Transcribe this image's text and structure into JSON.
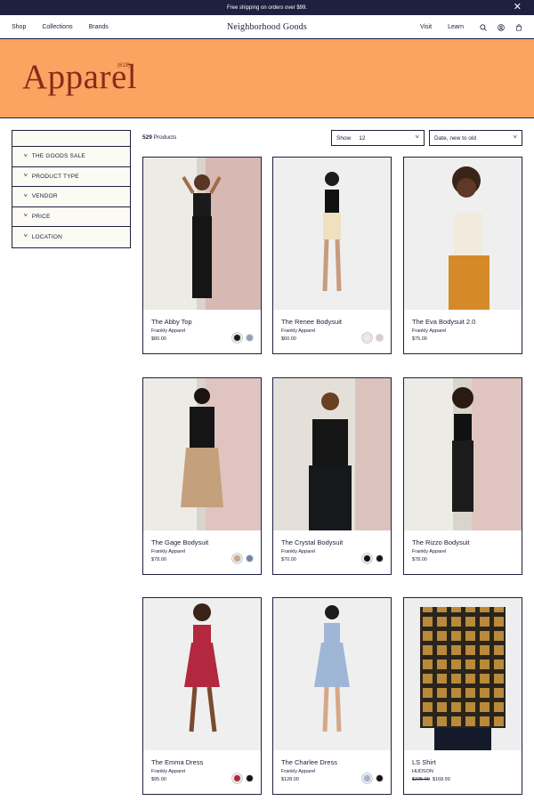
{
  "announcement": {
    "text": "Free shipping on orders over $99."
  },
  "header": {
    "nav_left": [
      "Shop",
      "Collections",
      "Brands"
    ],
    "logo": "Neighborhood Goods",
    "nav_right": [
      "Visit",
      "Learn"
    ],
    "icons": [
      "search-icon",
      "account-icon",
      "cart-icon"
    ]
  },
  "hero": {
    "title": "Apparel",
    "count": "(619)"
  },
  "sidebar": {
    "filters": [
      "THE GOODS SALE",
      "PRODUCT TYPE",
      "VENDOR",
      "PRICE",
      "LOCATION"
    ]
  },
  "toolbar": {
    "product_count": "529",
    "product_label": "Products",
    "show_label": "Show",
    "show_value": "12",
    "sort_value": "Date, new to old"
  },
  "products": [
    {
      "name": "The Abby Top",
      "vendor": "Frankly Apparel",
      "price": "$80.00",
      "swatches": [
        "#1c1c1c",
        "#8fa2b8"
      ]
    },
    {
      "name": "The Renee Bodysuit",
      "vendor": "Frankly Apparel",
      "price": "$60.00",
      "swatches": [
        "#efece4",
        "#d9c9d0"
      ]
    },
    {
      "name": "The Eva Bodysuit 2.0",
      "vendor": "Frankly Apparel",
      "price": "$75.00",
      "swatches": []
    },
    {
      "name": "The Gage Bodysuit",
      "vendor": "Frankly Apparel",
      "price": "$78.00",
      "swatches": [
        "#c9a98c",
        "#6f86a6"
      ]
    },
    {
      "name": "The Crystal Bodysuit",
      "vendor": "Frankly Apparel",
      "price": "$70.00",
      "swatches": [
        "#151515",
        "#151515"
      ]
    },
    {
      "name": "The Rizzo Bodysuit",
      "vendor": "Frankly Apparel",
      "price": "$78.00",
      "swatches": []
    },
    {
      "name": "The Emma Dress",
      "vendor": "Frankly Apparel",
      "price": "$95.00",
      "swatches": [
        "#b3283f",
        "#151515"
      ]
    },
    {
      "name": "The Charlee Dress",
      "vendor": "Frankly Apparel",
      "price": "$128.00",
      "swatches": [
        "#9fb6d6",
        "#151515"
      ]
    },
    {
      "name": "LS Shirt",
      "vendor": "HUDSON",
      "price_original": "$225.00",
      "price": "$168.99",
      "swatches": []
    }
  ],
  "colors": {
    "navy": "#1f2040",
    "hero_orange": "#fba462",
    "hero_title": "#8b2a1a",
    "sidebar_bg": "#fbfaf3"
  }
}
